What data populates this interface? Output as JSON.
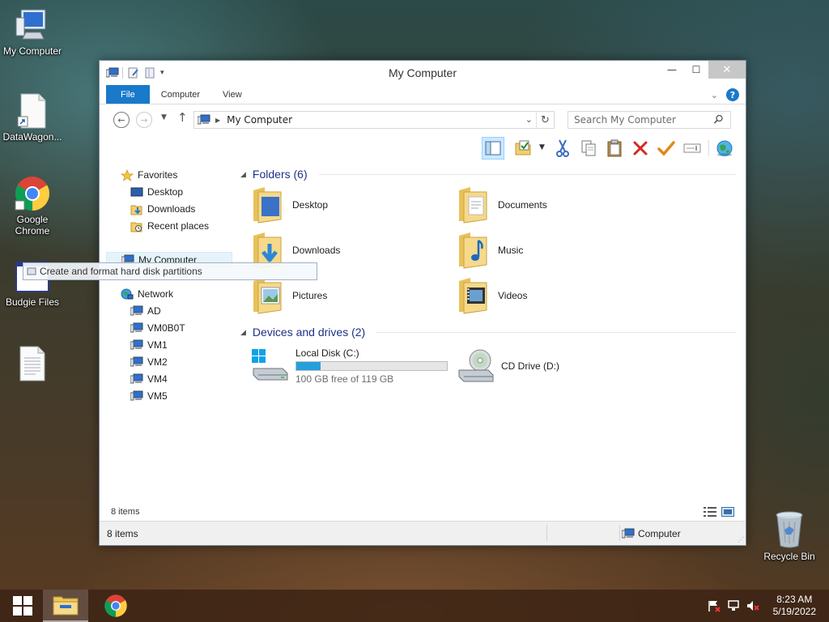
{
  "desktop": {
    "icons": [
      {
        "label": "My Computer"
      },
      {
        "label": "DataWagon..."
      },
      {
        "label": "Google Chrome"
      },
      {
        "label": "Budgie Files"
      },
      {
        "label": ""
      }
    ],
    "recycle_bin": {
      "label": "Recycle Bin"
    }
  },
  "window": {
    "title": "My Computer",
    "ribbon_tabs": [
      {
        "label": "File"
      },
      {
        "label": "Computer"
      },
      {
        "label": "View"
      }
    ],
    "address": {
      "path": "My Computer"
    },
    "search": {
      "placeholder": "Search My Computer"
    },
    "nav": {
      "favorites": {
        "label": "Favorites",
        "items": [
          {
            "label": "Desktop"
          },
          {
            "label": "Downloads"
          },
          {
            "label": "Recent places"
          }
        ]
      },
      "my_computer": {
        "label": "My Computer"
      },
      "network": {
        "label": "Network",
        "items": [
          {
            "label": "AD"
          },
          {
            "label": "VM0B0T"
          },
          {
            "label": "VM1"
          },
          {
            "label": "VM2"
          },
          {
            "label": "VM4"
          },
          {
            "label": "VM5"
          }
        ]
      }
    },
    "folders_group": {
      "title": "Folders (6)",
      "items": [
        {
          "label": "Desktop"
        },
        {
          "label": "Documents"
        },
        {
          "label": "Downloads"
        },
        {
          "label": "Music"
        },
        {
          "label": "Pictures"
        },
        {
          "label": "Videos"
        }
      ]
    },
    "drives_group": {
      "title": "Devices and drives (2)",
      "items": [
        {
          "label": "Local Disk (C:)",
          "free_text": "100 GB free of 119 GB",
          "used_fraction": 0.16
        },
        {
          "label": "CD Drive (D:)"
        }
      ]
    },
    "item_count": "8 items",
    "status": {
      "left": "8 items",
      "right": "Computer"
    }
  },
  "tooltip": {
    "text": "Create and format hard disk partitions"
  },
  "taskbar": {
    "clock": {
      "time": "8:23 AM",
      "date": "5/19/2022"
    }
  },
  "colors": {
    "accent": "#1979ca",
    "group_header": "#1e3287",
    "drive_fill": "#26a0da"
  }
}
